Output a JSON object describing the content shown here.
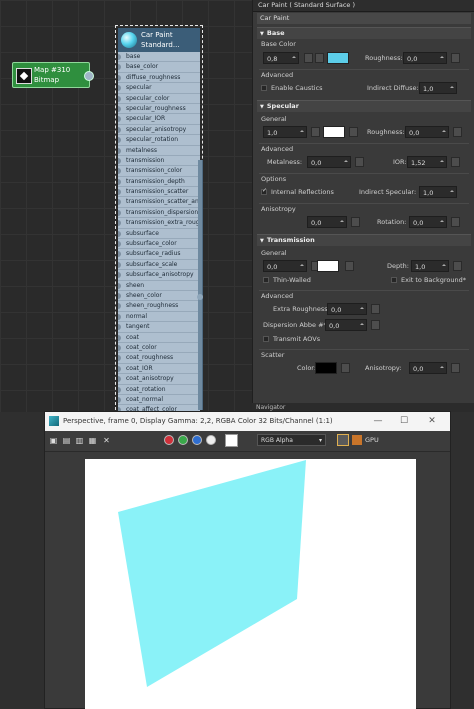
{
  "node_editor": {
    "bitmap_node": {
      "line1": "Map #310",
      "line2": "Bitmap"
    },
    "material_node": {
      "title_line1": "Car Paint",
      "title_line2": "Standard...",
      "sockets": [
        "base",
        "base_color",
        "diffuse_roughness",
        "specular",
        "specular_color",
        "specular_roughness",
        "specular_IOR",
        "specular_anisotropy",
        "specular_rotation",
        "metalness",
        "transmission",
        "transmission_color",
        "transmission_depth",
        "transmission_scatter",
        "transmission_scatter_ani...",
        "transmission_dispersion*",
        "transmission_extra_roug...",
        "subsurface",
        "subsurface_color",
        "subsurface_radius",
        "subsurface_scale",
        "subsurface_anisotropy",
        "sheen",
        "sheen_color",
        "sheen_roughness",
        "normal",
        "tangent",
        "coat",
        "coat_color",
        "coat_roughness",
        "coat_IOR",
        "coat_anisotropy",
        "coat_rotation",
        "coat_normal",
        "coat_affect_color"
      ]
    }
  },
  "panel": {
    "title": "Car Paint  ( Standard Surface )",
    "name_field": "Car Paint",
    "base": {
      "header": "Base",
      "color_label": "Base Color",
      "weight": "0,8",
      "color": "#5ccde8",
      "roughness_label": "Roughness:",
      "roughness": "0,0",
      "advanced_label": "Advanced",
      "caustics_label": "Enable Caustics",
      "indirect_diffuse_label": "Indirect Diffuse:",
      "indirect_diffuse": "1,0"
    },
    "specular": {
      "header": "Specular",
      "general_label": "General",
      "weight": "1,0",
      "color": "#ffffff",
      "roughness_label": "Roughness:",
      "roughness": "0,0",
      "advanced_label": "Advanced",
      "metalness_label": "Metalness:",
      "metalness": "0,0",
      "ior_label": "IOR:",
      "ior": "1,52",
      "options_label": "Options",
      "internal_reflections_label": "Internal Reflections",
      "indirect_specular_label": "Indirect Specular:",
      "indirect_specular": "1,0",
      "anisotropy_label": "Anisotropy",
      "anisotropy": "0,0",
      "rotation_label": "Rotation:",
      "rotation": "0,0"
    },
    "transmission": {
      "header": "Transmission",
      "general_label": "General",
      "weight": "0,0",
      "color": "#ffffff",
      "depth_label": "Depth:",
      "depth": "1,0",
      "thin_walled_label": "Thin-Walled",
      "exit_label": "Exit to Background*",
      "advanced_label": "Advanced",
      "extra_roughness_label": "Extra Roughness:",
      "extra_roughness": "0,0",
      "dispersion_label": "Dispersion Abbe #*:",
      "dispersion": "0,0",
      "transmit_aovs_label": "Transmit AOVs",
      "scatter_label": "Scatter",
      "scatter_color_label": "Color:",
      "scatter_color": "#000000",
      "anisotropy_label": "Anisotropy:",
      "anisotropy": "0,0"
    },
    "navigator_label": "Navigator"
  },
  "render_window": {
    "title": "Perspective, frame 0, Display Gamma: 2,2, RGBA Color 32 Bits/Channel (1:1)",
    "channel": "RGB Alpha",
    "gpu_label": "GPU",
    "plane_color": "#8af2f8"
  }
}
